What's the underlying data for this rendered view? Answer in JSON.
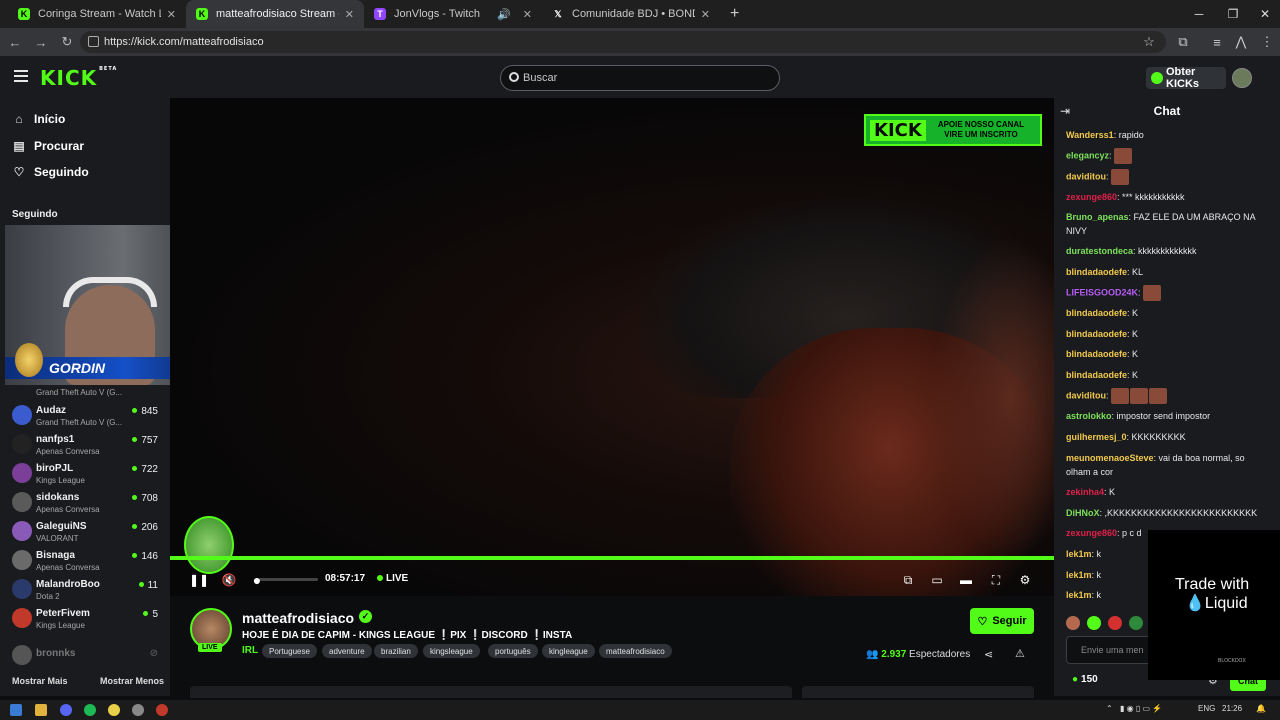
{
  "browser": {
    "tabs": [
      {
        "title": "Coringa Stream - Watch Live o",
        "favicon": "kick"
      },
      {
        "title": "matteafrodisiaco Stream - Watc",
        "favicon": "kick"
      },
      {
        "title": "JonVlogs - Twitch",
        "favicon": "twitch"
      },
      {
        "title": "Comunidade BDJ • BONDE DO",
        "favicon": "x"
      }
    ],
    "active_tab": 1,
    "url": "https://kick.com/matteafrodisiaco"
  },
  "header": {
    "logo": "KICK",
    "logo_badge": "BETA",
    "search_placeholder": "Buscar",
    "get_kicks": "Obter KICKs"
  },
  "sidebar": {
    "nav": [
      {
        "label": "Início",
        "icon": "home-icon"
      },
      {
        "label": "Procurar",
        "icon": "browse-icon"
      },
      {
        "label": "Seguindo",
        "icon": "heart-icon"
      }
    ],
    "following_heading": "Seguindo",
    "preview": {
      "banner_name": "GORDIN",
      "first_item_category": "Grand Theft Auto V (G..."
    },
    "channels": [
      {
        "name": "Audaz",
        "category": "Grand Theft Auto V (G...",
        "viewers": "845",
        "color": "#3b5ccf"
      },
      {
        "name": "nanfps1",
        "category": "Apenas Conversa",
        "viewers": "757",
        "color": "#222222"
      },
      {
        "name": "biroPJL",
        "category": "Kings League",
        "viewers": "722",
        "color": "#7b3f9a"
      },
      {
        "name": "sidokans",
        "category": "Apenas Conversa",
        "viewers": "708",
        "color": "#5a5a5a"
      },
      {
        "name": "GaleguiNS",
        "category": "VALORANT",
        "viewers": "206",
        "color": "#8a5ab8"
      },
      {
        "name": "Bisnaga",
        "category": "Apenas Conversa",
        "viewers": "146",
        "color": "#6a6a6a"
      },
      {
        "name": "MalandroBoo",
        "category": "Dota 2",
        "viewers": "11",
        "color": "#2a3a6a"
      },
      {
        "name": "PeterFivem",
        "category": "Kings League",
        "viewers": "5",
        "color": "#c0392b"
      }
    ],
    "offline_channel": "bronnks",
    "show_more": "Mostrar Mais",
    "show_less": "Mostrar Menos"
  },
  "video": {
    "overlay_logo": "KICK",
    "overlay_text_1": "APOIE NOSSO CANAL",
    "overlay_text_2": "VIRE UM INSCRITO",
    "time": "08:57:17",
    "live": "LIVE",
    "progress": 1.0
  },
  "stream": {
    "channel": "matteafrodisiaco",
    "live_badge": "LIVE",
    "title": "HOJE É DIA DE CAPIM - KINGS LEAGUE ❕PIX ❕DISCORD ❕INSTA",
    "category": "IRL",
    "tags": [
      "Portuguese",
      "adventure",
      "brazilian",
      "kingsleague",
      "português",
      "kingleague",
      "matteafrodisiaco"
    ],
    "follow": "Seguir",
    "viewers": "2.937",
    "viewers_label": "Espectadores"
  },
  "chat": {
    "title": "Chat",
    "messages": [
      {
        "user": "Wanderss1",
        "color": "#f2c94c",
        "text": "rapido",
        "emotes": 0
      },
      {
        "user": "elegancyz",
        "color": "#7ee05a",
        "text": "",
        "emotes": 1
      },
      {
        "user": "daviditou",
        "color": "#f2c94c",
        "text": "",
        "emotes": 1
      },
      {
        "user": "zexunge860",
        "color": "#e0204a",
        "text": "*** kkkkkkkkkkk",
        "emotes": 0
      },
      {
        "user": "Bruno_apenas",
        "color": "#7ee05a",
        "text": "FAZ ELE DA UM ABRAÇO NA NIVY",
        "emotes": 0
      },
      {
        "user": "duratestondeca",
        "color": "#7ee05a",
        "text": "kkkkkkkkkkkkk",
        "emotes": 0
      },
      {
        "user": "blindadaodefe",
        "color": "#f2c94c",
        "text": "KL",
        "emotes": 0
      },
      {
        "user": "LIFEISGOOD24K",
        "color": "#b55cf5",
        "text": "",
        "emotes": 1
      },
      {
        "user": "blindadaodefe",
        "color": "#f2c94c",
        "text": "K",
        "emotes": 0
      },
      {
        "user": "blindadaodefe",
        "color": "#f2c94c",
        "text": "K",
        "emotes": 0
      },
      {
        "user": "blindadaodefe",
        "color": "#f2c94c",
        "text": "K",
        "emotes": 0
      },
      {
        "user": "blindadaodefe",
        "color": "#f2c94c",
        "text": "K",
        "emotes": 0
      },
      {
        "user": "daviditou",
        "color": "#f2c94c",
        "text": "",
        "emotes": 3
      },
      {
        "user": "astrolokko",
        "color": "#7ee05a",
        "text": "impostor send impostor",
        "emotes": 0
      },
      {
        "user": "guilhermesj_0",
        "color": "#f2c94c",
        "text": "KKKKKKKKK",
        "emotes": 0
      },
      {
        "user": "meunomenaoeSteve",
        "color": "#f2c94c",
        "text": "vai da boa normal, so olham a cor",
        "emotes": 0
      },
      {
        "user": "zekinha4",
        "color": "#e0204a",
        "text": "K",
        "emotes": 0
      },
      {
        "user": "DiHNoX",
        "color": "#7ee05a",
        "text": ",KKKKKKKKKKKKKKKKKKKKKKKKK",
        "emotes": 0
      },
      {
        "user": "zexunge860",
        "color": "#e0204a",
        "text": "p c d",
        "emotes": 0
      },
      {
        "user": "lek1m",
        "color": "#f2c94c",
        "text": "k",
        "emotes": 0
      },
      {
        "user": "lek1m",
        "color": "#f2c94c",
        "text": "k",
        "emotes": 0
      },
      {
        "user": "lek1m",
        "color": "#f2c94c",
        "text": "k",
        "emotes": 0
      }
    ],
    "input_placeholder": "Envie uma men",
    "kicks": "150",
    "send": "Chat",
    "ad_line1": "Trade with",
    "ad_line2": "Liquid",
    "ad_brand": "BLOCKDOX"
  },
  "taskbar": {
    "lang": "ENG",
    "time": "21:26"
  }
}
